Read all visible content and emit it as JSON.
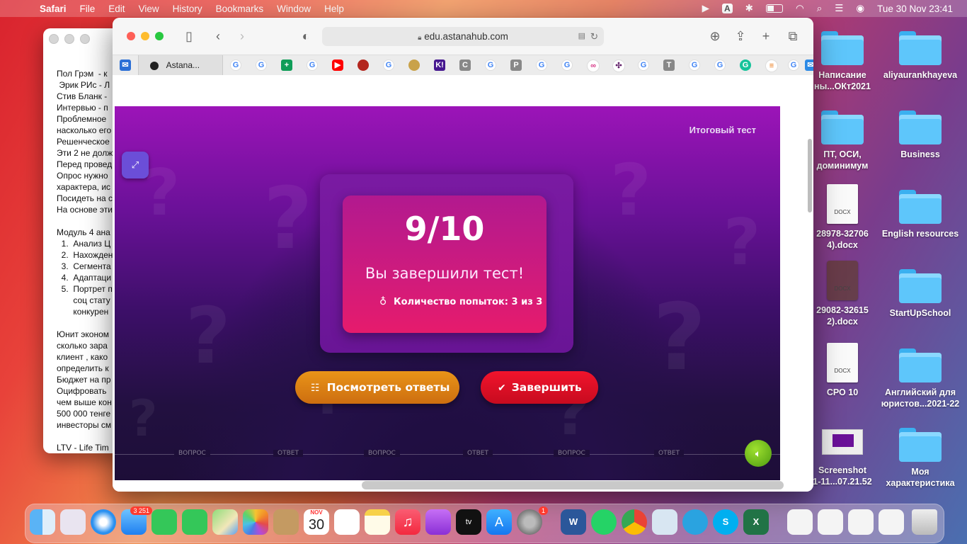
{
  "menubar": {
    "app": "Safari",
    "items": [
      "File",
      "Edit",
      "View",
      "History",
      "Bookmarks",
      "Window",
      "Help"
    ],
    "input_source": "A",
    "datetime": "Tue 30 Nov  23:41"
  },
  "desktop": {
    "icons": [
      {
        "label": "Написание\nны...ОКт2021",
        "type": "folder"
      },
      {
        "label": "aliyaurankhayeva",
        "type": "folder"
      },
      {
        "label": "ПТ, ОСИ,\nдоминимум",
        "type": "folder"
      },
      {
        "label": "Business",
        "type": "folder"
      },
      {
        "label": "28978-32706\n4).docx",
        "type": "doc"
      },
      {
        "label": "English resources",
        "type": "folder"
      },
      {
        "label": "29082-32615\n2).docx",
        "type": "doc"
      },
      {
        "label": "StartUpSchool",
        "type": "folder"
      },
      {
        "label": "СРО 10",
        "type": "doc"
      },
      {
        "label": "Английский для\nюристов...2021-22",
        "type": "folder"
      },
      {
        "label": "Screenshot\n1-11...07.21.52",
        "type": "image"
      },
      {
        "label": "Моя\nхарактеристика",
        "type": "folder"
      }
    ],
    "doc_label": "DOCX"
  },
  "editor": {
    "text": "Пол Грэм  - к\n Эрик РИс - Л\nСтив Бланк -\nИнтервью - п\nПроблемное\nнасколько его\nРешенческое\nЭти 2 не долж\nПеред провед\nОпрос нужно\nхарактера, ис\nПосидеть на с\nНа основе эти\n\nМодуль 4 ана\n  1.  Анализ Ц\n  2.  Нахожден\n  3.  Сегмента\n  4.  Адаптаци\n  5.  Портрет п\n       соц стату\n       конкурен\n\nЮнит эконом\nсколько зара\nклиент , како\nопределить к\nБюджет на пр\nОцифровать\nчем выше кон\n500 000 тенге\nинвесторы см\n\nLTV - Life Tim"
  },
  "browser": {
    "url": "edu.astanahub.com",
    "active_tab": "Astana...",
    "tab_icons": [
      "mail",
      "astana",
      "G",
      "G",
      "sheets",
      "G",
      "youtube",
      "red-circle",
      "G",
      "emblem",
      "K!",
      "G",
      "C",
      "G",
      "P",
      "G",
      "G",
      "pink",
      "slack",
      "G",
      "T",
      "G",
      "G",
      "grammarly",
      "layers",
      "G",
      "mail2"
    ]
  },
  "quiz": {
    "title": "Итоговый тест",
    "score": "9/10",
    "message": "Вы завершили тест!",
    "attempts": "Количество попыток: 3 из 3",
    "view_answers": "Посмотреть ответы",
    "finish": "Завершить",
    "progress_labels": [
      "ВОПРОС",
      "ОТВЕТ",
      "ВОПРОС",
      "ОТВЕТ",
      "ВОПРОС",
      "ОТВЕТ"
    ]
  },
  "dock": {
    "mail_badge": "3 251",
    "calendar_month": "NOV",
    "calendar_day": "30",
    "settings_badge": "1"
  }
}
